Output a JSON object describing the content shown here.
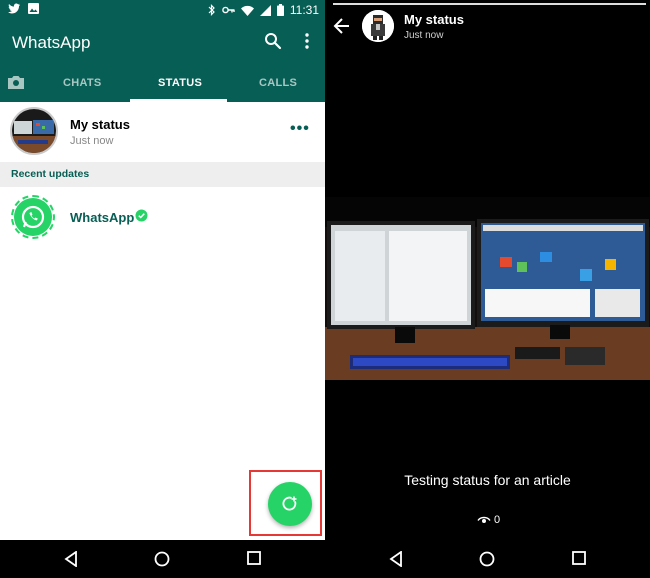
{
  "status_bar": {
    "time": "11:31"
  },
  "app": {
    "title": "WhatsApp"
  },
  "tabs": {
    "chats": "CHATS",
    "status": "STATUS",
    "calls": "CALLS"
  },
  "my_status": {
    "name": "My status",
    "time": "Just now",
    "more": "•••"
  },
  "recent_updates": {
    "label": "Recent updates"
  },
  "updates": [
    {
      "name": "WhatsApp",
      "verified": true
    }
  ],
  "viewer": {
    "name": "My status",
    "time": "Just now",
    "caption": "Testing status for an article",
    "views": "0"
  },
  "colors": {
    "primary": "#075e54",
    "accent": "#25d366",
    "highlight": "#e53935"
  },
  "icons": [
    "twitter-icon",
    "image-icon",
    "bluetooth-icon",
    "key-icon",
    "wifi-icon",
    "signal-icon",
    "battery-icon",
    "search-icon",
    "more-vert-icon",
    "camera-icon",
    "verified-icon",
    "add-status-icon",
    "back-arrow-icon",
    "eye-icon",
    "nav-back-icon",
    "nav-home-icon",
    "nav-recents-icon"
  ]
}
